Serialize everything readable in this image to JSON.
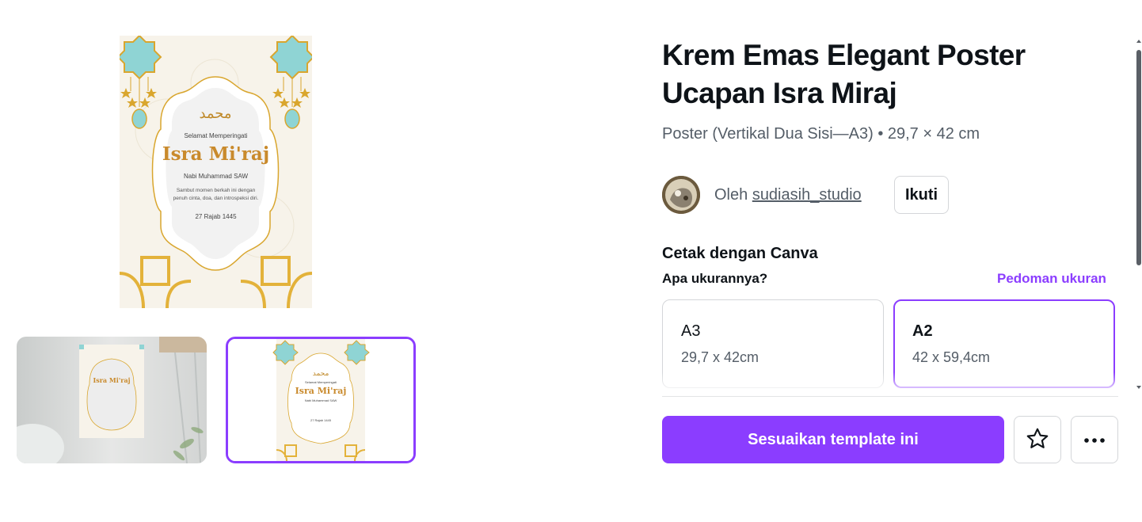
{
  "template": {
    "title": "Krem Emas Elegant Poster Ucapan Isra Miraj",
    "subtitle": "Poster (Vertikal Dua Sisi—A3) • 29,7 × 42 cm"
  },
  "poster": {
    "greeting": "Selamat Memperingati",
    "headline": "Isra Mi'raj",
    "name": "Nabi Muhammad SAW",
    "message_line1": "Sambut momen berkah ini dengan",
    "message_line2": "penuh cinta, doa, dan introspeksi diri.",
    "date": "27 Rajab 1445",
    "colors": {
      "background": "#f7f3ea",
      "gold": "#d9a62e",
      "teal": "#8fd4d4",
      "frame": "#eeeeee"
    }
  },
  "creator": {
    "by_label": "Oleh",
    "username": "sudiasih_studio",
    "follow_label": "Ikuti"
  },
  "print": {
    "heading": "Cetak dengan Canva",
    "size_question": "Apa ukurannya?",
    "size_guide_label": "Pedoman ukuran",
    "sizes": [
      {
        "name": "A3",
        "dimensions": "29,7 x 42cm",
        "selected": false
      },
      {
        "name": "A2",
        "dimensions": "42 x 59,4cm",
        "selected": true
      }
    ]
  },
  "actions": {
    "customize_label": "Sesuaikan template ini",
    "favorite_icon": "star-icon",
    "more_icon": "more-horizontal-icon"
  },
  "theme": {
    "accent": "#8b3dff",
    "text": "#0e1318",
    "muted": "#545d67"
  }
}
